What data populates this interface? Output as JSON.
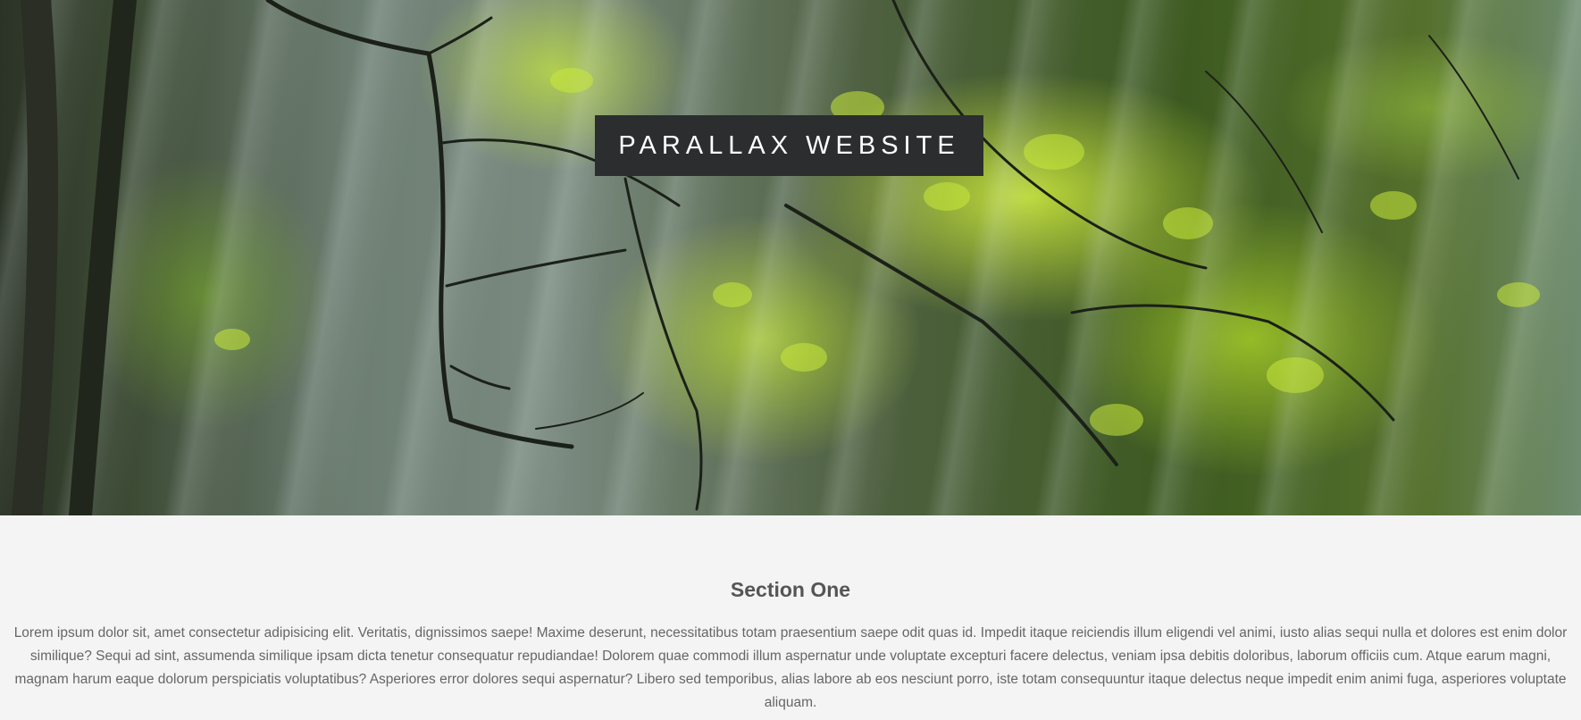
{
  "hero": {
    "title": "PARALLAX WEBSITE",
    "background_image": "forest-canopy-sunrays-image"
  },
  "section_one": {
    "heading": "Section One",
    "body": "Lorem ipsum dolor sit, amet consectetur adipisicing elit. Veritatis, dignissimos saepe! Maxime deserunt, necessitatibus totam praesentium saepe odit quas id. Impedit itaque reiciendis illum eligendi vel animi, iusto alias sequi nulla et dolores est enim dolor similique? Sequi ad sint, assumenda similique ipsam dicta tenetur consequatur repudiandae! Dolorem quae commodi illum aspernatur unde voluptate excepturi facere delectus, veniam ipsa debitis doloribus, laborum officiis cum. Atque earum magni, magnam harum eaque dolorum perspiciatis voluptatibus? Asperiores error dolores sequi aspernatur? Libero sed temporibus, alias labore ab eos nesciunt porro, iste totam consequuntur itaque delectus neque impedit enim animi fuga, asperiores voluptate aliquam."
  },
  "colors": {
    "title_box_bg": "#2b2d2e",
    "title_text": "#ffffff",
    "section_bg": "#f4f4f4",
    "heading_text": "#555555",
    "body_text": "#666666"
  }
}
